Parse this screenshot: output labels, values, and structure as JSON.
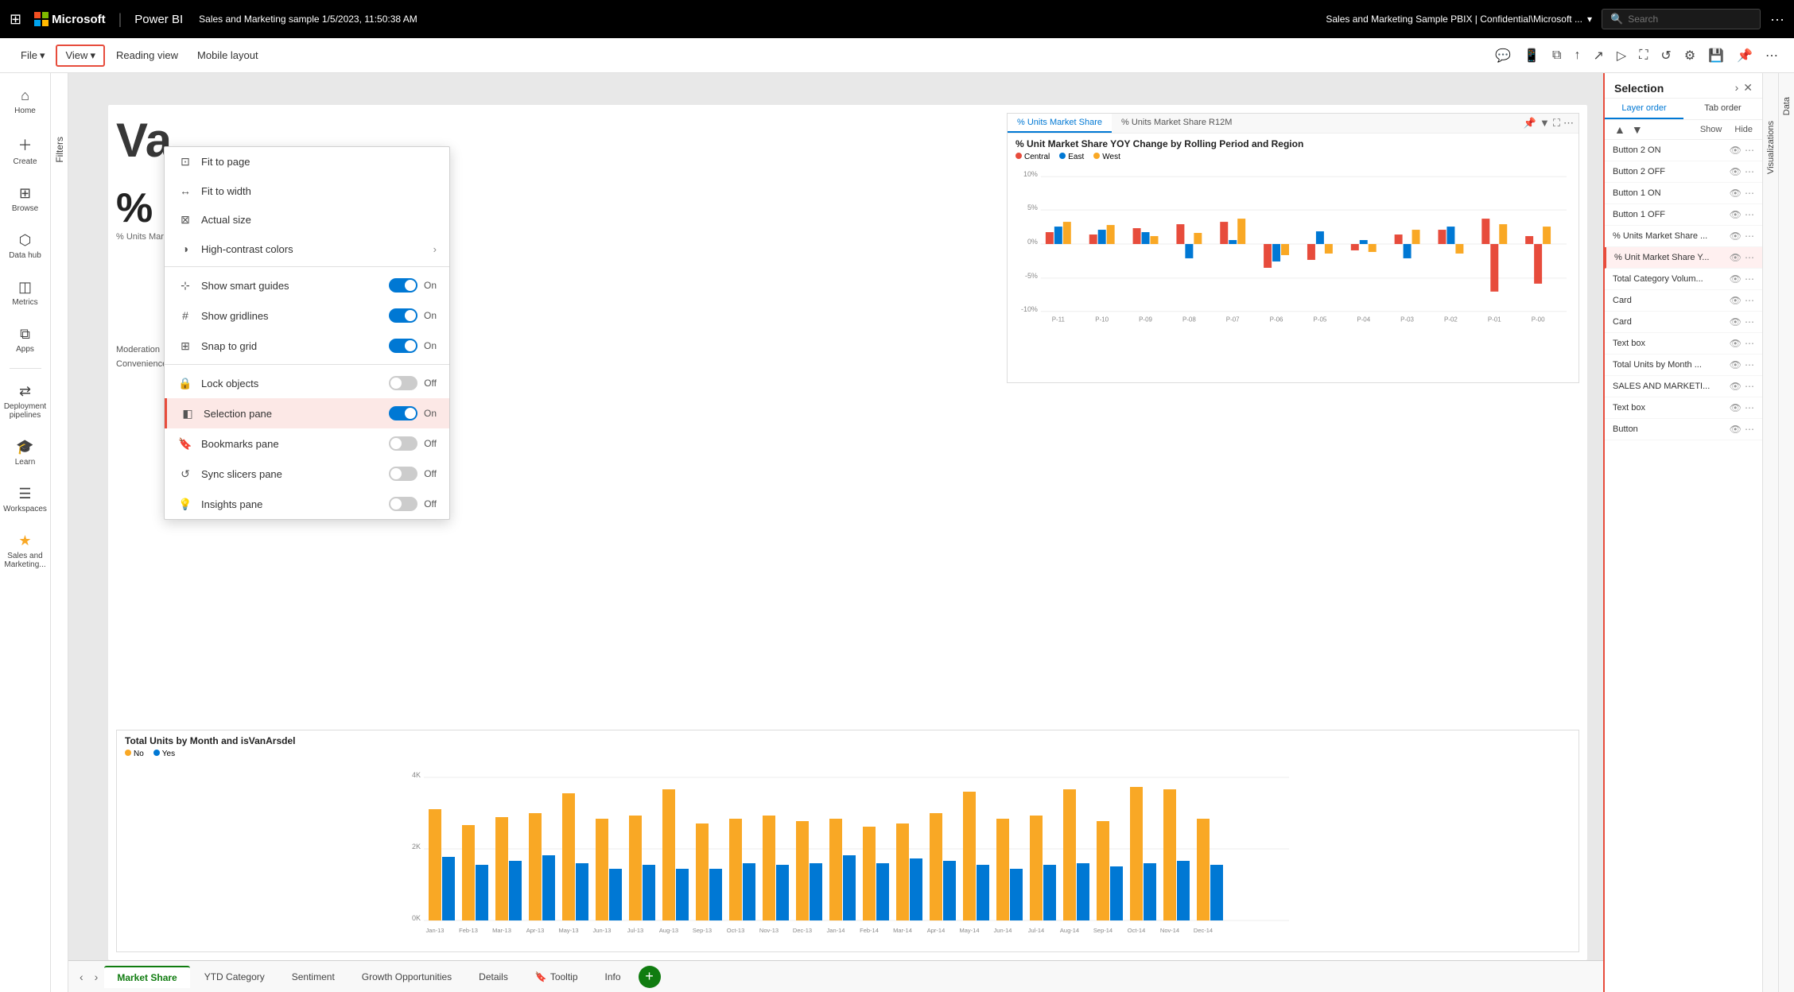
{
  "topbar": {
    "product": "Power BI",
    "doc_title": "Sales and Marketing sample  1/5/2023, 11:50:38 AM",
    "doc_path": "Sales and Marketing Sample PBIX  |  Confidential\\Microsoft ...",
    "search_placeholder": "Search",
    "more_btn": "···"
  },
  "ribbon": {
    "file_label": "File",
    "view_label": "View",
    "reading_view_label": "Reading view",
    "mobile_layout_label": "Mobile layout"
  },
  "view_dropdown": {
    "fit_to_page": "Fit to page",
    "fit_to_width": "Fit to width",
    "actual_size": "Actual size",
    "high_contrast": "High-contrast colors",
    "show_smart_guides": "Show smart guides",
    "show_gridlines": "Show gridlines",
    "snap_to_grid": "Snap to grid",
    "lock_objects": "Lock objects",
    "selection_pane": "Selection pane",
    "bookmarks_pane": "Bookmarks pane",
    "sync_slicers_pane": "Sync slicers pane",
    "insights_pane": "Insights pane",
    "on_label": "On",
    "off_label": "Off"
  },
  "sidebar": {
    "items": [
      {
        "label": "Home",
        "icon": "⌂"
      },
      {
        "label": "Create",
        "icon": "+"
      },
      {
        "label": "Browse",
        "icon": "⊞"
      },
      {
        "label": "Data hub",
        "icon": "⬡"
      },
      {
        "label": "Metrics",
        "icon": "◫"
      },
      {
        "label": "Apps",
        "icon": "⧉"
      },
      {
        "label": "Deployment pipelines",
        "icon": "⇄"
      },
      {
        "label": "Learn",
        "icon": "🎓"
      },
      {
        "label": "Workspaces",
        "icon": "☰"
      },
      {
        "label": "Sales and Marketing...",
        "icon": "★"
      }
    ]
  },
  "filters_panel": {
    "label": "Filters"
  },
  "canvas": {
    "page_title": "Va...",
    "chart_top": {
      "tab1": "% Units Market Share",
      "tab2": "% Units Market Share R12M",
      "title": "% Unit Market Share YOY Change by Rolling Period and Region",
      "legend": [
        "Central",
        "East",
        "West"
      ],
      "legend_colors": [
        "#e74c3c",
        "#0078d4",
        "#f9a825"
      ],
      "x_labels": [
        "P-11",
        "P-10",
        "P-09",
        "P-08",
        "P-07",
        "P-06",
        "P-05",
        "P-04",
        "P-03",
        "P-02",
        "P-01",
        "P-00"
      ],
      "y_labels": [
        "10%",
        "5%",
        "0%",
        "-5%",
        "-10%"
      ]
    },
    "chart_bottom": {
      "title": "Total Units by Month and isVanArsdel",
      "legend": [
        "No",
        "Yes"
      ],
      "legend_colors": [
        "#f9a825",
        "#0078d4"
      ],
      "y_labels": [
        "4K",
        "2K",
        "0K"
      ],
      "x_labels": [
        "Jan-13",
        "Feb-13",
        "Mar-13",
        "Apr-13",
        "May-13",
        "Jun-13",
        "Jul-13",
        "Aug-13",
        "Sep-13",
        "Oct-13",
        "Nov-13",
        "Dec-13",
        "Jan-14",
        "Feb-14",
        "Mar-14",
        "Apr-14",
        "May-14",
        "Jun-14",
        "Jul-14",
        "Aug-14",
        "Sep-14",
        "Oct-14",
        "Nov-14",
        "Dec-14"
      ]
    },
    "ms_cards": [
      {
        "value": "%",
        "label": "% Units Market Share"
      }
    ],
    "segment_text": "Moderation\nConvenience"
  },
  "selection_panel": {
    "title": "Selection",
    "tab_layer": "Layer order",
    "tab_tab": "Tab order",
    "show_label": "Show",
    "hide_label": "Hide",
    "items": [
      {
        "label": "Button 2 ON",
        "selected": false
      },
      {
        "label": "Button 2 OFF",
        "selected": false
      },
      {
        "label": "Button 1 ON",
        "selected": false
      },
      {
        "label": "Button 1 OFF",
        "selected": false
      },
      {
        "label": "% Units Market Share ...",
        "selected": false
      },
      {
        "label": "% Unit Market Share Y...",
        "selected": true
      },
      {
        "label": "Total Category Volum...",
        "selected": false
      },
      {
        "label": "Card",
        "selected": false
      },
      {
        "label": "Card",
        "selected": false
      },
      {
        "label": "Text box",
        "selected": false
      },
      {
        "label": "Total Units by Month ...",
        "selected": false
      },
      {
        "label": "SALES AND MARKETI...",
        "selected": false
      },
      {
        "label": "Text box",
        "selected": false
      },
      {
        "label": "Button",
        "selected": false
      }
    ]
  },
  "viz_side": {
    "label": "Visualizations"
  },
  "data_side": {
    "label": "Data"
  },
  "bottom_tabs": {
    "nav_left": "‹",
    "nav_right": "›",
    "tabs": [
      "Market Share",
      "YTD Category",
      "Sentiment",
      "Growth Opportunities",
      "Details",
      "Tooltip",
      "Info"
    ],
    "active_tab": "Market Share",
    "add_btn": "+"
  },
  "colors": {
    "accent_green": "#107c10",
    "accent_red": "#e74c3c",
    "accent_blue": "#0078d4",
    "yellow": "#f9a825"
  }
}
